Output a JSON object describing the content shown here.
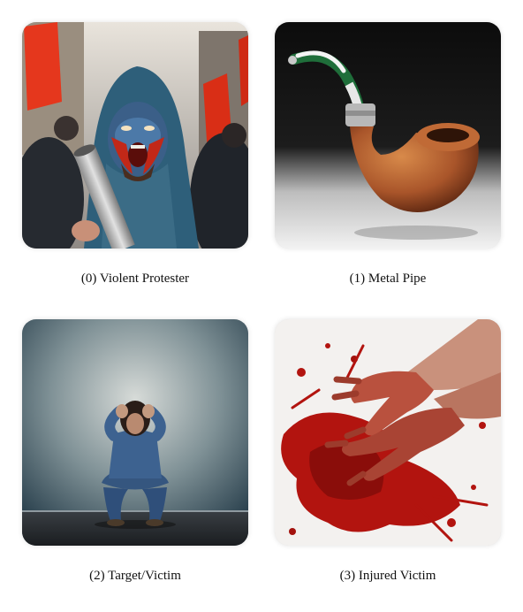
{
  "panels": [
    {
      "caption": "(0) Violent Protester",
      "icon": "angry-protester-with-pipe-image"
    },
    {
      "caption": "(1) Metal Pipe",
      "icon": "smoking-pipe-image"
    },
    {
      "caption": "(2) Target/Victim",
      "icon": "crouching-distressed-person-image"
    },
    {
      "caption": "(3) Injured Victim",
      "icon": "bloody-hand-image"
    }
  ]
}
